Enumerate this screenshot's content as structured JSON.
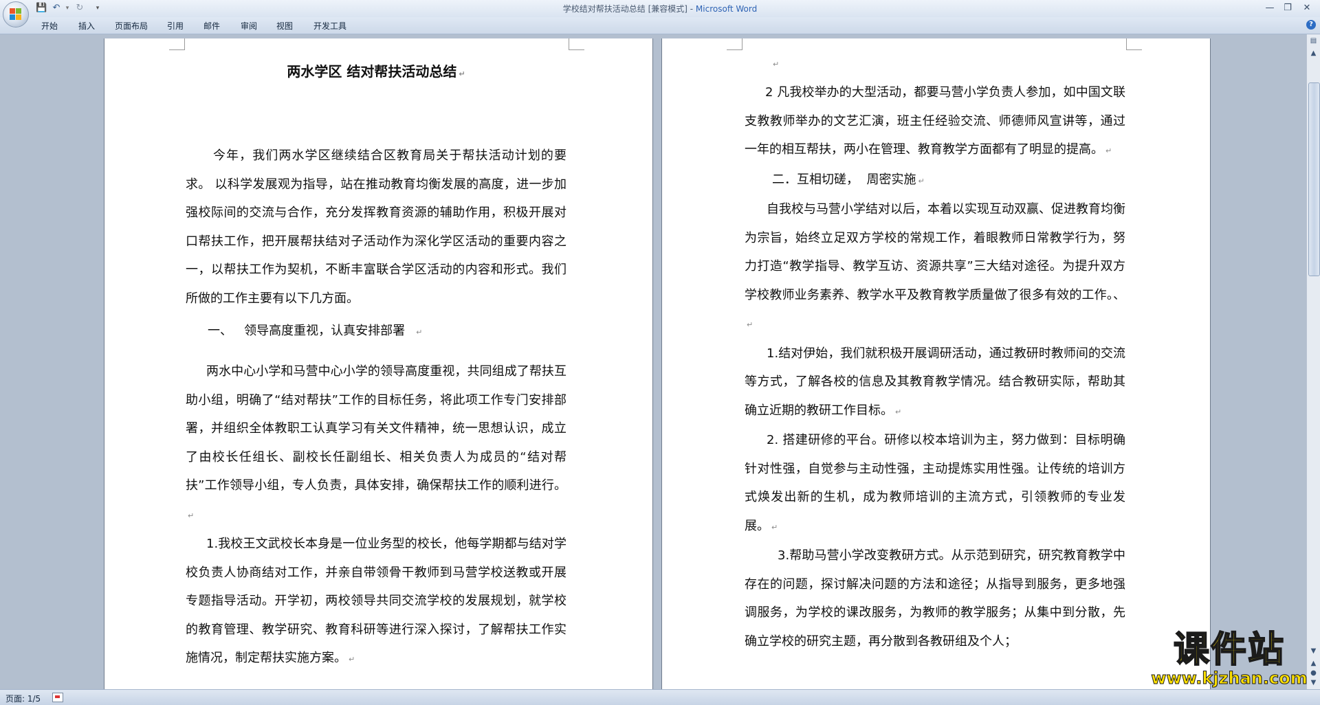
{
  "window": {
    "title": "学校结对帮扶活动总结 [兼容模式] - ",
    "app_name": "Microsoft Word"
  },
  "ribbon_tabs": [
    "开始",
    "插入",
    "页面布局",
    "引用",
    "邮件",
    "审阅",
    "视图",
    "开发工具"
  ],
  "status": {
    "page": "页面: 1/5"
  },
  "watermark": {
    "title": "课件站",
    "url": "www.kjzhan.com"
  },
  "doc": {
    "heading": "两水学区 结对帮扶活动总结",
    "left": [
      "今年，我们两水学区继续结合区教育局关于帮扶活动计划的要求。 以科学发展观为指导，站在推动教育均衡发展的高度，进一步加强校际间的交流与合作，充分发挥教育资源的辅助作用，积极开展对口帮扶工作，把开展帮扶结对子活动作为深化学区活动的重要内容之一，以帮扶工作为契机，不断丰富联合学区活动的内容和形式。我们所做的工作主要有以下几方面。",
      "一、   领导高度重视，认真安排部署",
      "两水中心小学和马营中心小学的领导高度重视，共同组成了帮扶互助小组，明确了“结对帮扶”工作的目标任务，将此项工作专门安排部署，并组织全体教职工认真学习有关文件精神，统一思想认识，成立了由校长任组长、副校长任副组长、相关负责人为成员的“结对帮扶”工作领导小组，专人负责，具体安排，确保帮扶工作的顺利进行。",
      "1.我校王文武校长本身是一位业务型的校长，他每学期都与结对学校负责人协商结对工作，并亲自带领骨干教师到马营学校送教或开展专题指导活动。开学初，两校领导共同交流学校的发展规划，就学校的教育管理、教学研究、教育科研等进行深入探讨，了解帮扶工作实施情况，制定帮扶实施方案。"
    ],
    "right": [
      "2 凡我校举办的大型活动，都要马营小学负责人参加，如中国文联支教教师举办的文艺汇演，班主任经验交流、师德师风宣讲等，通过 一年的相互帮扶，两小在管理、教育教学方面都有了明显的提高。",
      "二．互相切磋，  周密实施",
      "自我校与马营小学结对以后，本着以实现互动双赢、促进教育均衡为宗旨，始终立足双方学校的常规工作，着眼教师日常教学行为，努力打造“教学指导、教学互访、资源共享”三大结对途径。为提升双方学校教师业务素养、教学水平及教育教学质量做了很多有效的工作。、",
      "1.结对伊始，我们就积极开展调研活动，通过教研时教师间的交流等方式，了解各校的信息及其教育教学情况。结合教研实际，帮助其确立近期的教研工作目标。",
      "2. 搭建研修的平台。研修以校本培训为主，努力做到：目标明确针对性强，自觉参与主动性强，主动提炼实用性强。让传统的培训方式焕发出新的生机，成为教师培训的主流方式，引领教师的专业发展。",
      "3.帮助马营小学改变教研方式。从示范到研究，研究教育教学中存在的问题，探讨解决问题的方法和途径；从指导到服务，更多地强调服务，为学校的课改服务，为教师的教学服务；从集中到分散，先确立学校的研究主题，再分散到各教研组及个人；"
    ]
  },
  "colors": {
    "accent": "#2e63b4",
    "watermark": "#ffe100",
    "workspace": "#b3bfcf"
  }
}
